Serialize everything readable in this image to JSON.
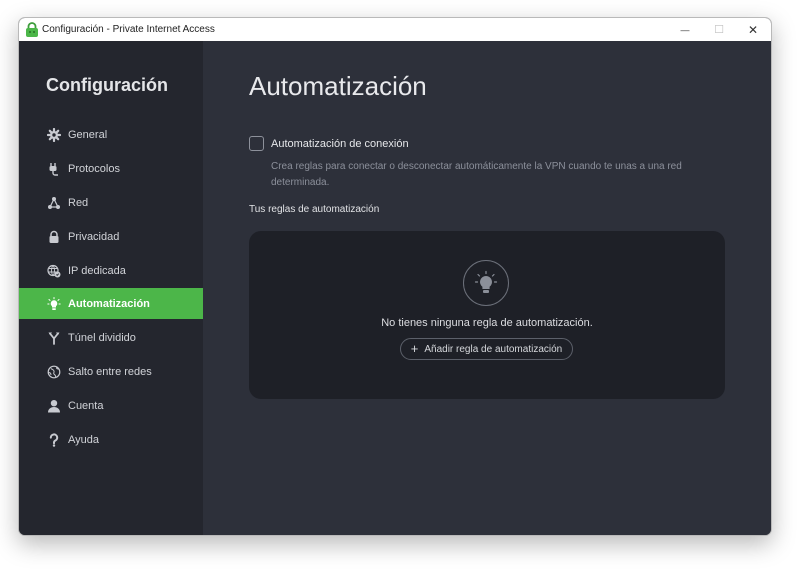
{
  "window": {
    "title": "Configuración - Private Internet Access",
    "controls": {
      "minimize": "—",
      "maximize": "☐",
      "close": "✕"
    }
  },
  "sidebar": {
    "title": "Configuración",
    "items": [
      {
        "label": "General",
        "icon": "gear-icon",
        "active": false
      },
      {
        "label": "Protocolos",
        "icon": "plug-icon",
        "active": false
      },
      {
        "label": "Red",
        "icon": "network-icon",
        "active": false
      },
      {
        "label": "Privacidad",
        "icon": "lock-icon",
        "active": false
      },
      {
        "label": "IP dedicada",
        "icon": "dedicated-ip-icon",
        "active": false
      },
      {
        "label": "Automatización",
        "icon": "lightbulb-icon",
        "active": true
      },
      {
        "label": "Túnel dividido",
        "icon": "split-tunnel-icon",
        "active": false
      },
      {
        "label": "Salto entre redes",
        "icon": "globe-icon",
        "active": false
      },
      {
        "label": "Cuenta",
        "icon": "user-icon",
        "active": false
      },
      {
        "label": "Ayuda",
        "icon": "question-icon",
        "active": false
      }
    ]
  },
  "main": {
    "title": "Automatización",
    "connection_automation": {
      "label": "Automatización de conexión",
      "checked": false,
      "description": "Crea reglas para conectar o desconectar automáticamente la VPN cuando te unas a una red determinada."
    },
    "rules_label": "Tus reglas de automatización",
    "empty_state": {
      "message": "No tienes ninguna regla de automatización.",
      "add_button_label": "Añadir regla de automatización",
      "add_icon": "+"
    }
  },
  "colors": {
    "accent": "#4cb649",
    "sidebar_bg": "#24262e",
    "main_bg": "#2d303a",
    "panel_bg": "#1e2027"
  }
}
